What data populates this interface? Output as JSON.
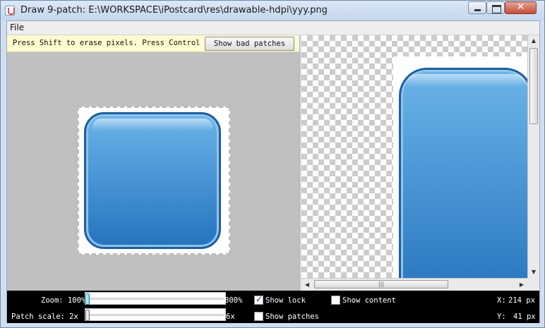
{
  "window": {
    "title": "Draw 9-patch: E:\\WORKSPACE\\iPostcard\\res\\drawable-hdpi\\yyy.png",
    "close_symbol": "✕"
  },
  "menu": {
    "file": "File"
  },
  "editor": {
    "hint": "Press Shift to erase pixels. Press Control to draw layout bounds",
    "bad_patches_label": "Show bad patches"
  },
  "scrollbars": {
    "up": "▲",
    "down": "▼",
    "left": "◀",
    "right": "▶",
    "grip": "|||"
  },
  "status": {
    "zoom_label": "Zoom: 100%",
    "zoom_max": "800%",
    "zoom_value_percent": 100,
    "patch_scale_label": "Patch scale:  2x",
    "patch_scale_max": "6x",
    "patch_scale_value": 2,
    "show_lock": {
      "label": "Show lock",
      "checked": true
    },
    "show_content": {
      "label": "Show content",
      "checked": false
    },
    "show_patches": {
      "label": "Show patches",
      "checked": false
    },
    "x_label": "X:",
    "x_value": "214 px",
    "y_label": "Y:",
    "y_value": "41 px"
  },
  "colors": {
    "button_blue_top": "#6bb4e8",
    "button_blue_bottom": "#2673bd",
    "editor_bg": "#c0c0c0",
    "status_bg": "#000000"
  }
}
